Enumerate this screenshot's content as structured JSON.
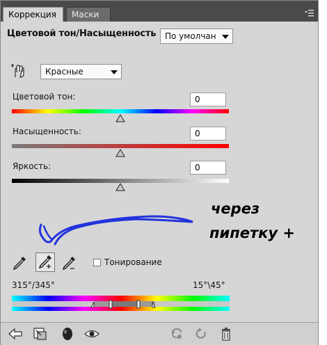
{
  "tabs": {
    "correction": "Коррекция",
    "masks": "Маски"
  },
  "header": {
    "title": "Цветовой тон/Насыщенность",
    "preset_value": "По умолчан"
  },
  "channel": {
    "value": "Красные"
  },
  "sliders": {
    "hue": {
      "label": "Цветовой тон:",
      "value": "0",
      "level": 0.5
    },
    "saturation": {
      "label": "Насыщенность:",
      "value": "0",
      "level": 0.5
    },
    "lightness": {
      "label": "Яркость:",
      "value": "0",
      "level": 0.5
    }
  },
  "tools": {
    "colorize_label": "Тонирование"
  },
  "range": {
    "left": "315°/345°",
    "right": "15°\\45°"
  },
  "annotation": {
    "line1": "через",
    "line2": "пипетку +"
  },
  "icons": [
    "hand-adjust-icon",
    "eyedropper-icon",
    "eyedropper-plus-icon",
    "eyedropper-minus-icon",
    "back-arrow-icon",
    "clip-to-layer-icon",
    "visibility-circle-icon",
    "eye-icon",
    "reset-previous-icon",
    "reset-icon",
    "trash-icon",
    "panel-menu-icon"
  ]
}
